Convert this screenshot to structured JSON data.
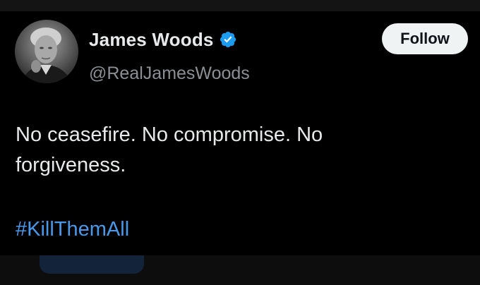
{
  "tweet": {
    "author": {
      "display_name": "James Woods",
      "handle": "@RealJamesWoods",
      "verified": true,
      "avatar_icon": "profile-photo"
    },
    "follow_label": "Follow",
    "text_lines": [
      "No ceasefire. No compromise. No",
      "forgiveness."
    ],
    "hashtag": "#KillThemAll"
  },
  "colors": {
    "background": "#000000",
    "text": "#e7e9ea",
    "handle": "#8b8f94",
    "hashtag": "#4a99e9",
    "verified_badge": "#1d9bf0",
    "follow_bg": "#eff3f4"
  }
}
